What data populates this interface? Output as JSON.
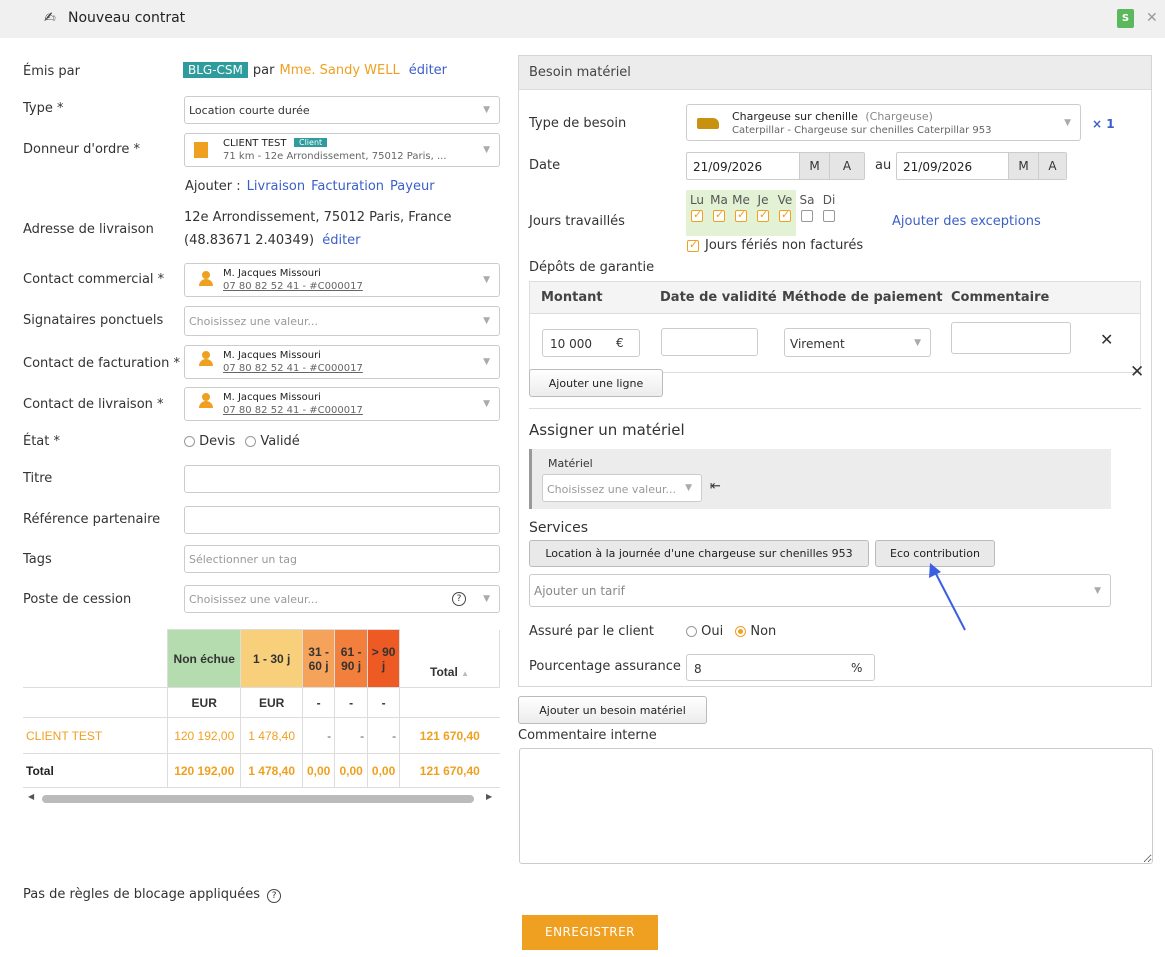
{
  "header": {
    "title": "Nouveau contrat",
    "badge": "S",
    "close": "✕"
  },
  "left": {
    "emis_par": {
      "label": "Émis par",
      "tag": "BLG-CSM",
      "par": "par",
      "person": "Mme. Sandy WELL",
      "edit": "éditer"
    },
    "type": {
      "label": "Type *",
      "value": "Location courte durée"
    },
    "donneur": {
      "label": "Donneur d'ordre *",
      "name": "CLIENT TEST",
      "badge": "Client",
      "sub": "71 km - 12e Arrondissement, 75012 Paris, ..."
    },
    "ajouter": {
      "label": "Ajouter :",
      "links": [
        "Livraison",
        "Facturation",
        "Payeur"
      ]
    },
    "adresse": {
      "label": "Adresse de livraison",
      "line1": "12e Arrondissement, 75012 Paris, France",
      "line2": "(48.83671 2.40349)",
      "edit": "éditer"
    },
    "contact_commercial": {
      "label": "Contact commercial *",
      "name": "M. Jacques Missouri",
      "sub": "07 80 82 52 41 - #C000017"
    },
    "signataires": {
      "label": "Signataires ponctuels",
      "placeholder": "Choisissez une valeur..."
    },
    "contact_facturation": {
      "label": "Contact de facturation *",
      "name": "M. Jacques Missouri",
      "sub": "07 80 82 52 41 - #C000017"
    },
    "contact_livraison": {
      "label": "Contact de livraison *",
      "name": "M. Jacques Missouri",
      "sub": "07 80 82 52 41 - #C000017"
    },
    "etat": {
      "label": "État *",
      "options": [
        "Devis",
        "Validé"
      ]
    },
    "titre": {
      "label": "Titre"
    },
    "reference": {
      "label": "Référence partenaire"
    },
    "tags": {
      "label": "Tags",
      "placeholder": "Sélectionner un tag"
    },
    "poste": {
      "label": "Poste de cession",
      "placeholder": "Choisissez une valeur...",
      "help": "?"
    }
  },
  "aging": {
    "headers": [
      "Non échue",
      "1 - 30 j",
      "31 - 60 j",
      "61 - 90 j",
      "> 90 j",
      "Total"
    ],
    "header_colors": [
      "#b5dcae",
      "#f8cf7a",
      "#f5a25a",
      "#f27f3c",
      "#ee5a24",
      "#ffffff"
    ],
    "currency_row": [
      "EUR",
      "EUR",
      "-",
      "-",
      "-"
    ],
    "rows": [
      {
        "name": "CLIENT TEST",
        "values": [
          "120 192,00",
          "1 478,40",
          "-",
          "-",
          "-",
          "121 670,40"
        ]
      },
      {
        "name": "Total",
        "values": [
          "120 192,00",
          "1 478,40",
          "0,00",
          "0,00",
          "0,00",
          "121 670,40"
        ]
      }
    ],
    "sort_icon": "▲"
  },
  "blocage": {
    "text": "Pas de règles de blocage appliquées",
    "help": "?"
  },
  "besoin": {
    "title": "Besoin matériel",
    "type_label": "Type de besoin",
    "type_name": "Chargeuse sur chenille",
    "type_cat": "(Chargeuse)",
    "type_sub": "Caterpillar - Chargeuse sur chenilles Caterpillar 953",
    "qty": "× 1",
    "date_label": "Date",
    "date_from": "21/09/2026",
    "au": "au",
    "date_to": "21/09/2026",
    "m": "M",
    "a": "A",
    "jours_label": "Jours travaillés",
    "days": [
      "Lu",
      "Ma",
      "Me",
      "Je",
      "Ve",
      "Sa",
      "Di"
    ],
    "days_checked": [
      true,
      true,
      true,
      true,
      true,
      false,
      false
    ],
    "exceptions": "Ajouter des exceptions",
    "feries": "Jours fériés non facturés",
    "depots_label": "Dépôts de garantie",
    "depots_headers": [
      "Montant",
      "Date de validité",
      "Méthode de paiement",
      "Commentaire"
    ],
    "depot_amount": "10 000",
    "depot_currency": "€",
    "depot_method": "Virement",
    "add_line": "Ajouter une ligne",
    "assign_title": "Assigner un matériel",
    "materiel_label": "Matériel",
    "materiel_placeholder": "Choisissez une valeur...",
    "services_label": "Services",
    "services": [
      "Location à la journée d'une chargeuse sur chenilles 953",
      "Eco contribution"
    ],
    "tarif_placeholder": "Ajouter un tarif",
    "assure_label": "Assuré par le client",
    "assure_options": [
      "Oui",
      "Non"
    ],
    "pourcentage_label": "Pourcentage assurance",
    "pourcentage_value": "8",
    "pourcentage_unit": "%"
  },
  "add_besoin": "Ajouter un besoin matériel",
  "commentaire_label": "Commentaire interne",
  "save": "ENREGISTRER",
  "colors": {
    "accent": "#f0a020",
    "tag_teal": "#2e9c9c",
    "link": "#3b5fc9",
    "arrow": "#3a5fe0"
  }
}
